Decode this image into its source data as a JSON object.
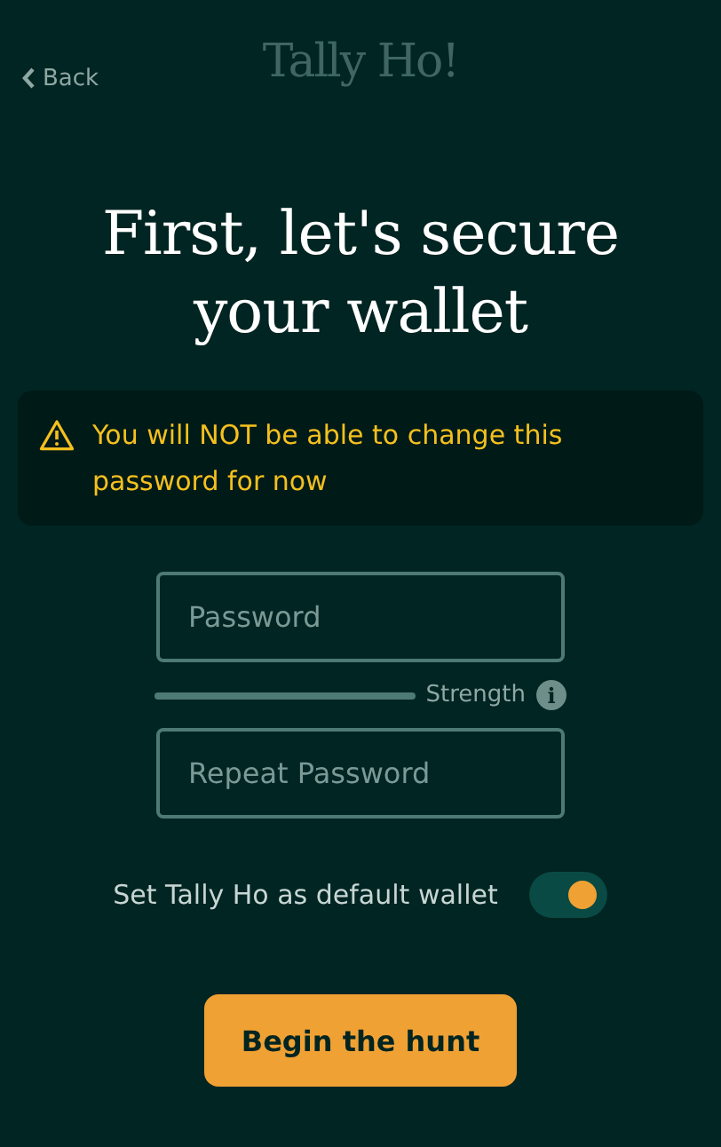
{
  "header": {
    "back_label": "Back",
    "logo": "Tally Ho!"
  },
  "title": "First, let's secure your wallet",
  "warning": "You will NOT be able to change this password for now",
  "fields": [
    {
      "placeholder": "Password"
    },
    {
      "placeholder": "Repeat Password"
    }
  ],
  "strength": {
    "label": "Strength",
    "info_icon": "i"
  },
  "default_wallet": {
    "label": "Set Tally Ho as default wallet",
    "on": true
  },
  "submit": "Begin the hunt"
}
